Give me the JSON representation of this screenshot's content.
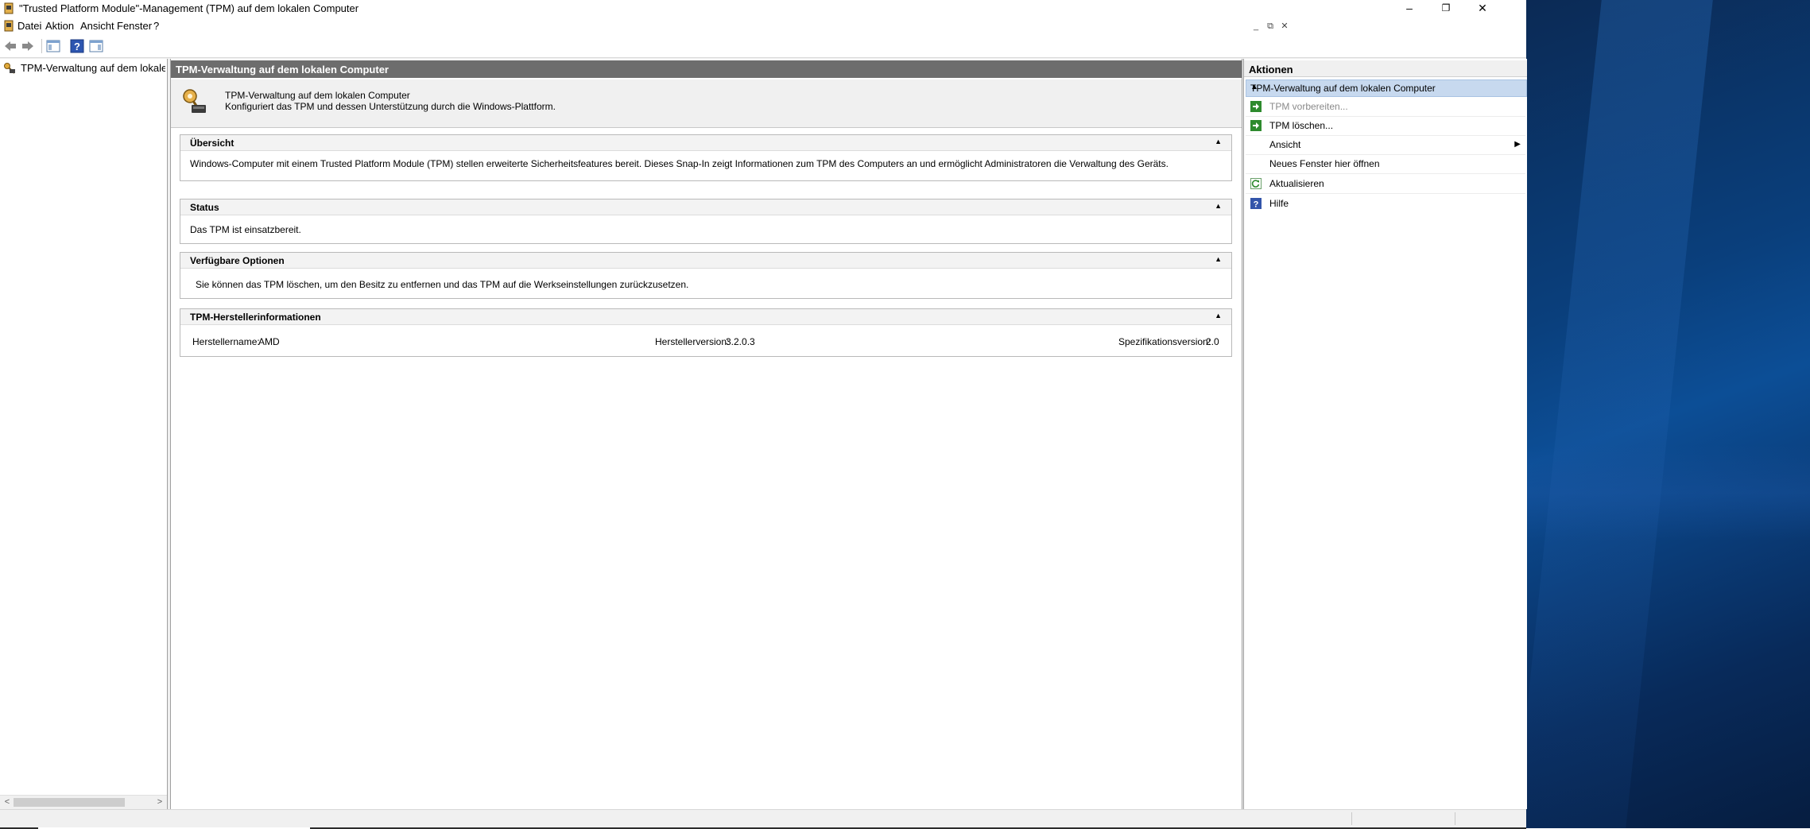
{
  "window": {
    "title": "\"Trusted Platform Module\"-Management (TPM) auf dem lokalen Computer",
    "minimize": "–",
    "restore": "❐",
    "close": "✕"
  },
  "menubar": {
    "items": [
      "Datei",
      "Aktion",
      "Ansicht",
      "Fenster",
      "?"
    ],
    "mdi_minimize": "_",
    "mdi_restore": "⧉",
    "mdi_close": "✕"
  },
  "tree": {
    "item_label": "TPM-Verwaltung auf dem lokalen Computer"
  },
  "center": {
    "header": "TPM-Verwaltung auf dem lokalen Computer",
    "intro_line1": "TPM-Verwaltung auf dem lokalen Computer",
    "intro_line2": "Konfiguriert das TPM und dessen Unterstützung durch die Windows-Plattform.",
    "sections": {
      "overview": {
        "title": "Übersicht",
        "text": "Windows-Computer mit einem Trusted Platform Module (TPM) stellen erweiterte Sicherheitsfeatures bereit. Dieses Snap-In zeigt Informationen zum TPM des Computers an und ermöglicht Administratoren die Verwaltung des Geräts."
      },
      "status": {
        "title": "Status",
        "text": "Das TPM ist einsatzbereit."
      },
      "options": {
        "title": "Verfügbare Optionen",
        "text": "Sie können das TPM löschen, um den Besitz zu entfernen und das TPM auf die Werkseinstellungen zurückzusetzen."
      },
      "vendor": {
        "title": "TPM-Herstellerinformationen",
        "name_label": "Herstellername:",
        "name_value": "AMD",
        "version_label": "Herstellerversion:",
        "version_value": "3.2.0.3",
        "spec_label": "Spezifikationsversion:",
        "spec_value": "2.0"
      }
    },
    "collapse_glyph": "▲"
  },
  "actions": {
    "header": "Aktionen",
    "group_label": "TPM-Verwaltung auf dem lokalen Computer",
    "items": [
      {
        "label": "TPM vorbereiten...",
        "icon": "green-arrow-icon",
        "enabled": false
      },
      {
        "label": "TPM löschen...",
        "icon": "green-arrow-icon",
        "enabled": true
      },
      {
        "label": "Ansicht",
        "icon": "",
        "enabled": true,
        "submenu": true
      },
      {
        "label": "Neues Fenster hier öffnen",
        "icon": "",
        "enabled": true
      },
      {
        "label": "Aktualisieren",
        "icon": "refresh-icon",
        "enabled": true
      },
      {
        "label": "Hilfe",
        "icon": "help-icon",
        "enabled": true
      }
    ],
    "submenu_arrow": "▶"
  },
  "colors": {
    "center_header_bg": "#6d6d6d",
    "actions_selected_bg": "#c7d9ef",
    "accent_green": "#2e8b2e",
    "help_blue": "#3355aa"
  }
}
